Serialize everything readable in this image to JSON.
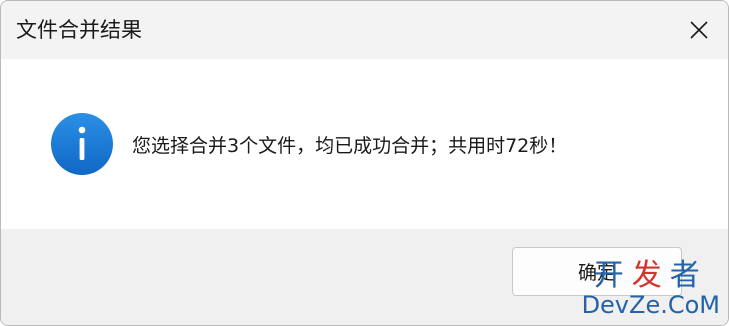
{
  "window": {
    "title": "文件合并结果",
    "close_icon": "close-icon"
  },
  "message": {
    "icon": "info-icon",
    "text": "您选择合并3个文件，均已成功合并；共用时72秒！"
  },
  "buttons": {
    "ok_label": "确定"
  },
  "watermark": {
    "line1_part1": "开",
    "line1_part2": "发",
    "line1_part3": "者",
    "line2": "DevZe.CoM"
  },
  "colors": {
    "info_icon": "#1a7fd9",
    "titlebar_bg": "#f3f3f3",
    "footer_bg": "#f0f0f0"
  }
}
